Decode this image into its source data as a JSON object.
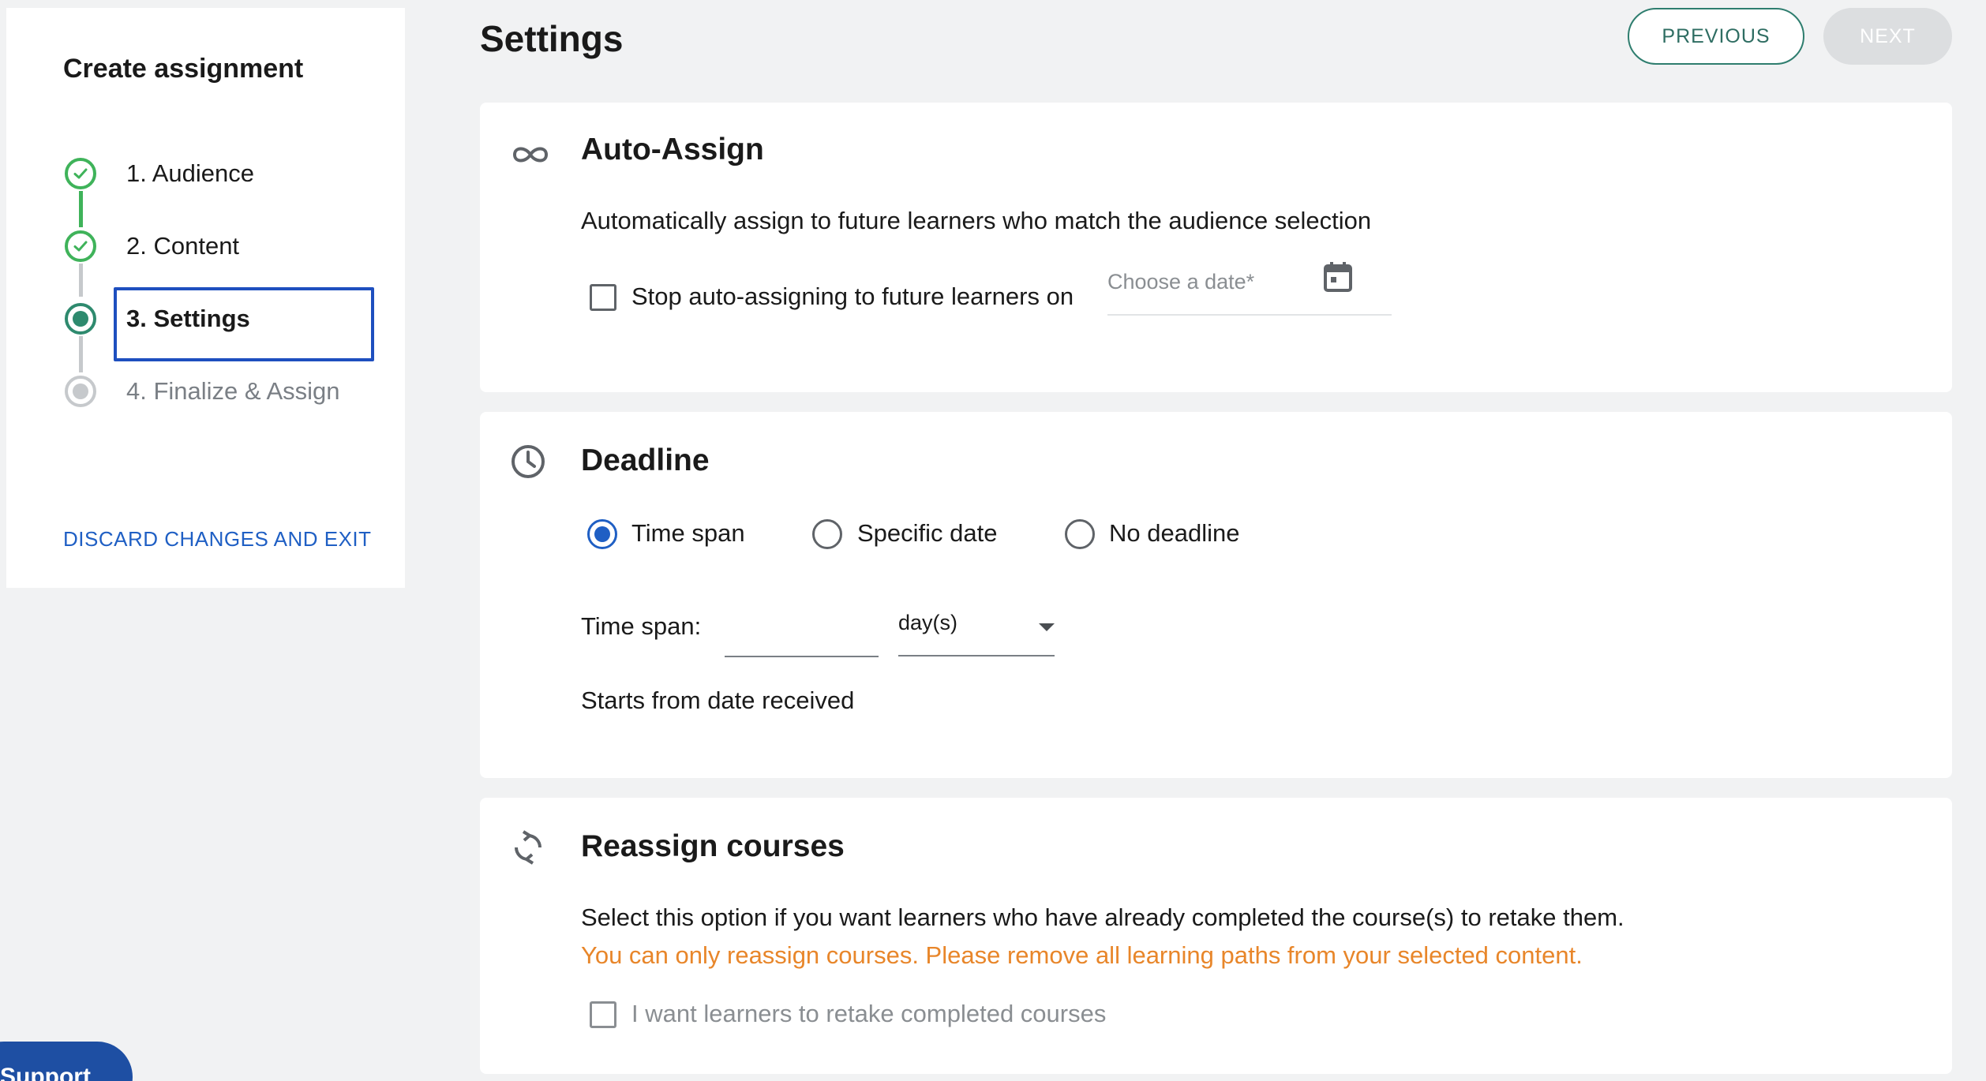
{
  "sidebar": {
    "title": "Create assignment",
    "steps": [
      {
        "label": "1. Audience",
        "state": "done"
      },
      {
        "label": "2. Content",
        "state": "done"
      },
      {
        "label": "3. Settings",
        "state": "current"
      },
      {
        "label": "4. Finalize & Assign",
        "state": "pending"
      }
    ],
    "discard_label": "DISCARD CHANGES AND EXIT"
  },
  "header": {
    "title": "Settings",
    "previous_label": "PREVIOUS",
    "next_label": "NEXT"
  },
  "auto_assign": {
    "title": "Auto-Assign",
    "description": "Automatically assign to future learners who match the audience selection",
    "stop_checkbox_label": "Stop auto-assigning to future learners on",
    "stop_checkbox_checked": false,
    "date_placeholder": "Choose a date*"
  },
  "deadline": {
    "title": "Deadline",
    "options": [
      "Time span",
      "Specific date",
      "No deadline"
    ],
    "selected": "Time span",
    "time_span_label": "Time span:",
    "time_span_value": "",
    "unit_value": "day(s)",
    "starts_text": "Starts from date received"
  },
  "reassign": {
    "title": "Reassign courses",
    "description": "Select this option if you want learners who have already completed the course(s) to retake them.",
    "warning": "You can only reassign courses. Please remove all learning paths from your selected content.",
    "checkbox_label": "I want learners to retake completed courses",
    "checkbox_checked": false
  },
  "support_label": "Support",
  "colors": {
    "accent_blue": "#1f5fc4",
    "success_green": "#3fb35a",
    "current_teal": "#2e8a6e",
    "warning_orange": "#e8862a",
    "support_blue": "#1e4fa3"
  }
}
